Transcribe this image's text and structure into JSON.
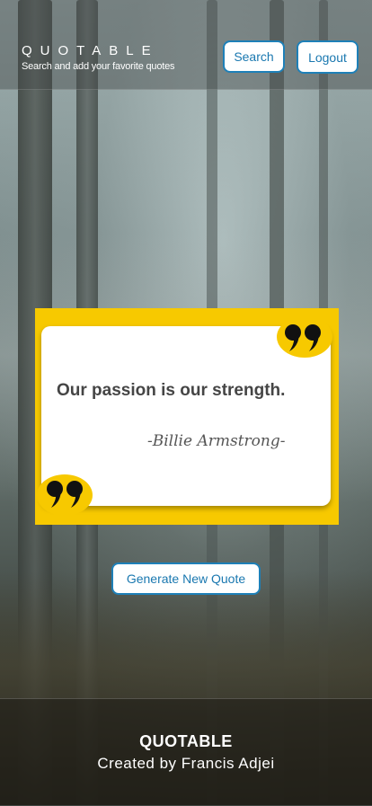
{
  "header": {
    "brand": "QUOTABLE",
    "tagline": "Search and add your favorite quotes",
    "search_label": "Search",
    "logout_label": "Logout"
  },
  "quote": {
    "text": "Our passion is our strength.",
    "author": "-Billie Armstrong-"
  },
  "actions": {
    "generate_label": "Generate New Quote"
  },
  "footer": {
    "title": "QUOTABLE",
    "credit": "Created by Francis Adjei"
  },
  "colors": {
    "accent_blue": "#1e80b8",
    "quote_yellow": "#f7c900"
  },
  "icons": {
    "background": "forest-background-image",
    "quote_open": "quote-mark-icon",
    "quote_close": "quote-mark-icon"
  }
}
